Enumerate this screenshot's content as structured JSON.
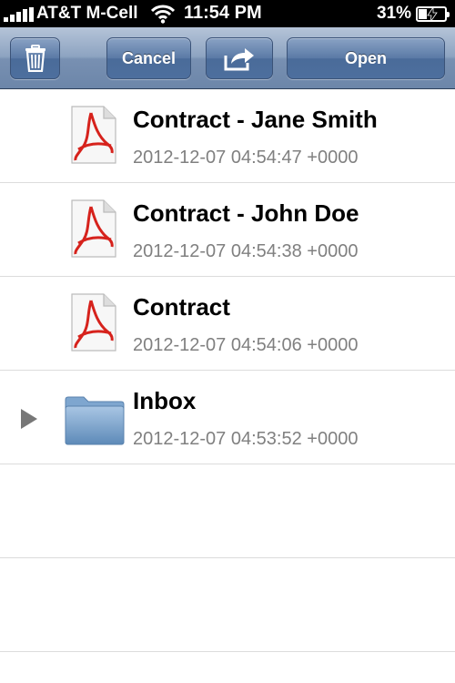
{
  "status_bar": {
    "carrier": "AT&T M-Cell",
    "time": "11:54 PM",
    "battery_percent": "31%",
    "battery_level": 0.31,
    "charging": true
  },
  "toolbar": {
    "trash_icon": "trash-icon",
    "cancel_label": "Cancel",
    "share_icon": "share-icon",
    "open_label": "Open"
  },
  "files": [
    {
      "title": "Contract - Jane Smith",
      "date": "2012-12-07 04:54:47 +0000",
      "icon": "pdf-file-icon"
    },
    {
      "title": "Contract - John Doe",
      "date": "2012-12-07 04:54:38 +0000",
      "icon": "pdf-file-icon"
    },
    {
      "title": "Contract",
      "date": "2012-12-07 04:54:06 +0000",
      "icon": "pdf-file-icon"
    },
    {
      "title": "Inbox",
      "date": "2012-12-07 04:53:52 +0000",
      "icon": "folder-icon"
    }
  ]
}
